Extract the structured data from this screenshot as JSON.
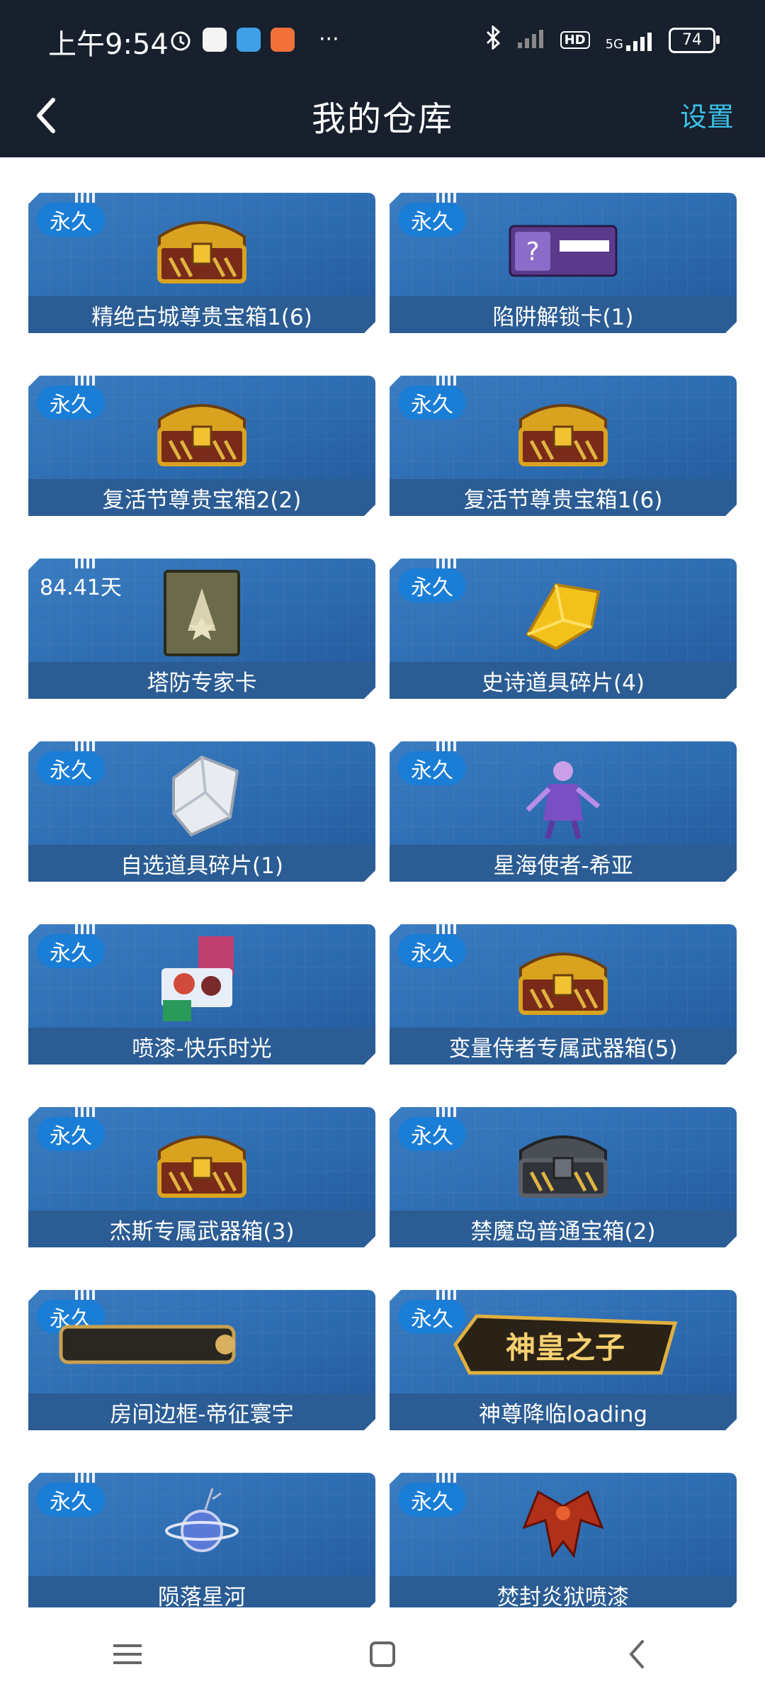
{
  "status": {
    "time": "上午9:54",
    "network": "5G",
    "hd": "HD",
    "battery": "74"
  },
  "appbar": {
    "title": "我的仓库",
    "settings": "设置"
  },
  "items": [
    {
      "tag": "永久",
      "name": "精绝古城尊贵宝箱1(6)",
      "icon": "gold-chest-icon"
    },
    {
      "tag": "永久",
      "name": "陷阱解锁卡(1)",
      "icon": "unlock-card-icon"
    },
    {
      "tag": "永久",
      "name": "复活节尊贵宝箱2(2)",
      "icon": "gold-chest-icon"
    },
    {
      "tag": "永久",
      "name": "复活节尊贵宝箱1(6)",
      "icon": "gold-chest-icon"
    },
    {
      "tag": "84.41天",
      "name": "塔防专家卡",
      "icon": "expert-card-icon"
    },
    {
      "tag": "永久",
      "name": "史诗道具碎片(4)",
      "icon": "gold-crystal-icon"
    },
    {
      "tag": "永久",
      "name": "自选道具碎片(1)",
      "icon": "silver-crystal-icon"
    },
    {
      "tag": "永久",
      "name": "星海使者-希亚",
      "icon": "character-icon"
    },
    {
      "tag": "永久",
      "name": "喷漆-快乐时光",
      "icon": "spray-icon"
    },
    {
      "tag": "永久",
      "name": "变量侍者专属武器箱(5)",
      "icon": "gold-chest-icon"
    },
    {
      "tag": "永久",
      "name": "杰斯专属武器箱(3)",
      "icon": "gold-chest-icon"
    },
    {
      "tag": "永久",
      "name": "禁魔岛普通宝箱(2)",
      "icon": "dark-chest-icon"
    },
    {
      "tag": "永久",
      "name": "房间边框-帝征寰宇",
      "icon": "frame-icon"
    },
    {
      "tag": "永久",
      "name": "神尊降临loading",
      "icon": "banner-icon",
      "banner_text": "神皇之子"
    },
    {
      "tag": "永久",
      "name": "陨落星河",
      "icon": "planet-icon"
    },
    {
      "tag": "永久",
      "name": "焚封炎狱喷漆",
      "icon": "dragon-icon"
    }
  ],
  "colors": {
    "bar_bg": "#17202c",
    "accent": "#3cc0e8",
    "card": "#2c6aae",
    "badge": "#1a7dd6"
  }
}
